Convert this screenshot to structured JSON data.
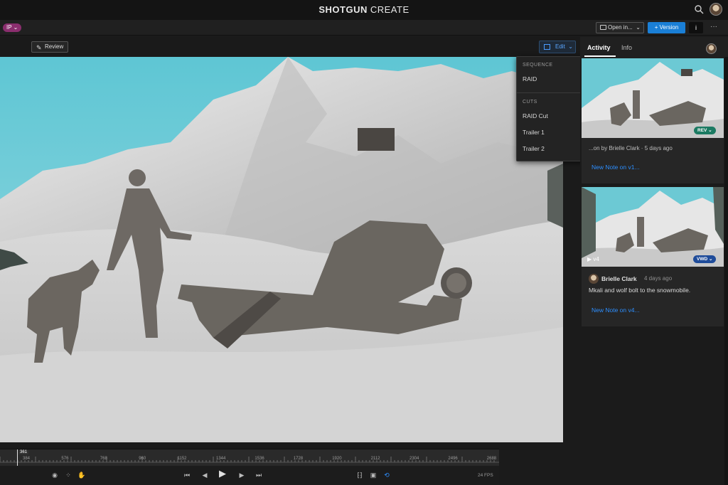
{
  "app": {
    "title_bold": "SHOTGUN",
    "title_rest": "CREATE"
  },
  "toolbar": {
    "project_badge": "IP ⌄",
    "open_in_label": "Open in...",
    "version_label": "+ Version",
    "info_label": "i",
    "more_label": "···"
  },
  "viewer_bar": {
    "review_label": "Review",
    "edit_label": "Edit"
  },
  "dropdown": {
    "sequence_header": "SEQUENCE",
    "sequence_items": [
      "RAID"
    ],
    "cuts_header": "CUTS",
    "cuts_items": [
      "RAID Cut",
      "Trailer 1",
      "Trailer 2"
    ]
  },
  "timeline": {
    "current_frame": "361",
    "ticks": [
      "384",
      "576",
      "768",
      "960",
      "1152",
      "1344",
      "1536",
      "1728",
      "1920",
      "2112",
      "2304",
      "2496",
      "2688"
    ],
    "fps": "24 FPS"
  },
  "panel": {
    "tabs": [
      "Activity",
      "Info"
    ],
    "card1": {
      "tag": "REV ⌄",
      "caption": "...on by Brielle Clark · 5 days ago",
      "link": "New Note on v1..."
    },
    "card2": {
      "version_label": "▶ v4",
      "tag": "VWD ⌄",
      "author": "Brielle Clark",
      "time": "4 days ago",
      "note": "Mkali and wolf bolt to the snowmobile.",
      "link": "New Note on v4..."
    }
  },
  "colors": {
    "accent": "#1a7fd6",
    "rev_tag": "#1b7a62",
    "vwd_tag": "#1f4c9a",
    "project_badge": "#8a2e6e"
  }
}
